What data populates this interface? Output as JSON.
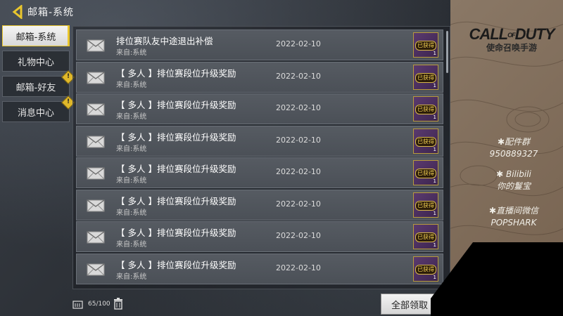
{
  "header": {
    "title": "邮箱-系统"
  },
  "tabs": [
    {
      "label": "邮箱-系统",
      "active": true,
      "alert": false
    },
    {
      "label": "礼物中心",
      "active": false,
      "alert": false
    },
    {
      "label": "邮箱-好友",
      "active": false,
      "alert": true
    },
    {
      "label": "消息中心",
      "active": false,
      "alert": true
    }
  ],
  "alert_glyph": "!",
  "mails": [
    {
      "subject": "排位赛队友中途退出补偿",
      "from": "来自:系统",
      "date": "2022-02-10",
      "badge": "已获得"
    },
    {
      "subject": "【 多人 】排位赛段位升级奖励",
      "from": "来自:系统",
      "date": "2022-02-10",
      "badge": "已获得"
    },
    {
      "subject": "【 多人 】排位赛段位升级奖励",
      "from": "来自:系统",
      "date": "2022-02-10",
      "badge": "已获得"
    },
    {
      "subject": "【 多人 】排位赛段位升级奖励",
      "from": "来自:系统",
      "date": "2022-02-10",
      "badge": "已获得"
    },
    {
      "subject": "【 多人 】排位赛段位升级奖励",
      "from": "来自:系统",
      "date": "2022-02-10",
      "badge": "已获得"
    },
    {
      "subject": "【 多人 】排位赛段位升级奖励",
      "from": "来自:系统",
      "date": "2022-02-10",
      "badge": "已获得"
    },
    {
      "subject": "【 多人 】排位赛段位升级奖励",
      "from": "来自:系统",
      "date": "2022-02-10",
      "badge": "已获得"
    },
    {
      "subject": "【 多人 】排位赛段位升级奖励",
      "from": "来自:系统",
      "date": "2022-02-10",
      "badge": "已获得"
    }
  ],
  "badge_count": "1",
  "footer": {
    "mailbox_count": "65/100",
    "claim_all_label": "全部领取"
  },
  "branding": {
    "logo_main_left": "CALL",
    "logo_of": "OF",
    "logo_main_right": "DUTY",
    "logo_sub": "使命召唤手游"
  },
  "streamer_info": [
    {
      "label": "✱配件群",
      "value": "950889327"
    },
    {
      "label": "✱ Bilibili",
      "value": "你的鬘宝"
    },
    {
      "label": "✱直播间微信",
      "value": "POPSHARK"
    }
  ],
  "colors": {
    "accent": "#e9c62d",
    "badge_purple": "#5a3a6e",
    "panel_bg": "#2b2f35",
    "right_panel": "#8a7866"
  }
}
